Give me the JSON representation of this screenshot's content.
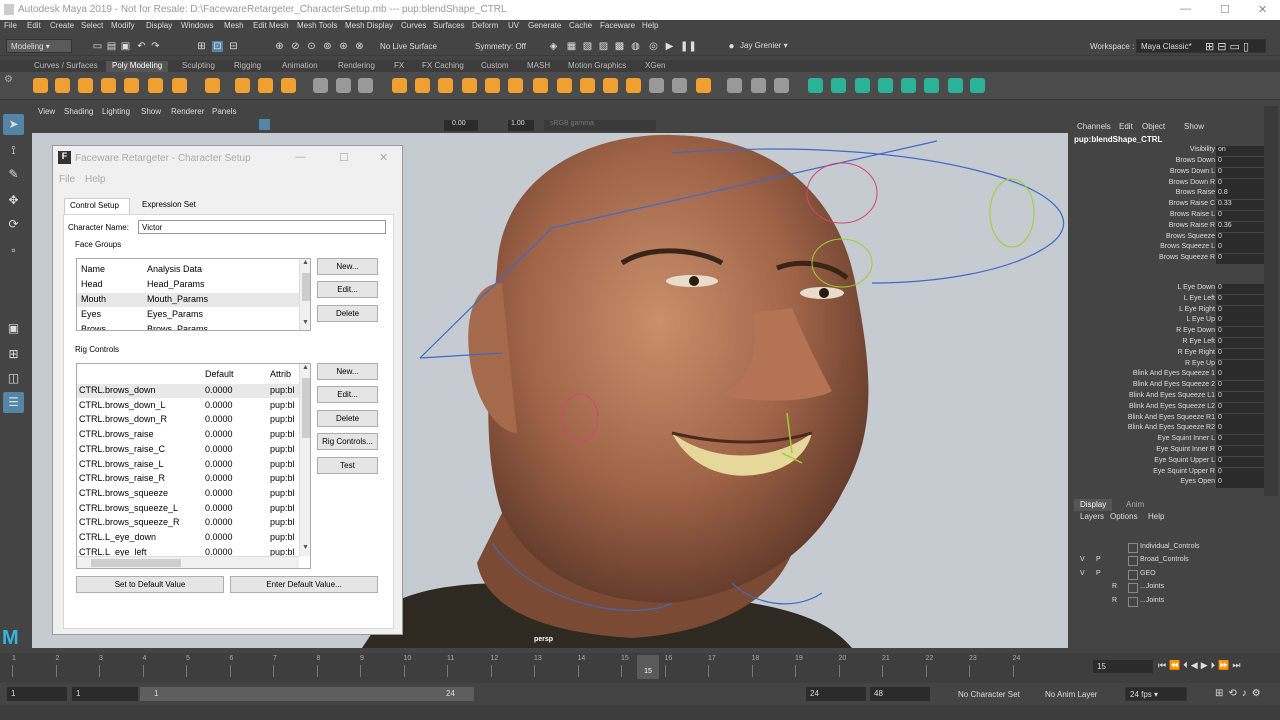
{
  "window": {
    "title": "Autodesk Maya 2019 - Not for Resale: D:\\FacewareRetargeter_CharacterSetup.mb  ---  pup:blendShape_CTRL"
  },
  "menubar": [
    "File",
    "Edit",
    "Create",
    "Select",
    "Modify",
    "Display",
    "Windows",
    "Mesh",
    "Edit Mesh",
    "Mesh Tools",
    "Mesh Display",
    "Curves",
    "Surfaces",
    "Deform",
    "UV",
    "Generate",
    "Cache",
    "Faceware",
    "Help"
  ],
  "statusline": {
    "mode": "Modeling",
    "live_surface": "No Live Surface",
    "symmetry": "Symmetry: Off",
    "user": "Jay Grenier",
    "workspace_label": "Workspace :",
    "workspace": "Maya Classic*"
  },
  "shelf_tabs": [
    "Curves / Surfaces",
    "Poly Modeling",
    "Sculpting",
    "Rigging",
    "Animation",
    "Rendering",
    "FX",
    "FX Caching",
    "Custom",
    "MASH",
    "Motion Graphics",
    "XGen"
  ],
  "shelf_active": "Poly Modeling",
  "panel_menu": [
    "View",
    "Shading",
    "Lighting",
    "Show",
    "Renderer",
    "Panels"
  ],
  "panel_toolbar": {
    "value1": "0.00",
    "value2": "1.00",
    "colorspace": "sRGB gamma"
  },
  "viewport": {
    "camera": "persp"
  },
  "channel_box": {
    "menu": [
      "Channels",
      "Edit",
      "Object",
      "Show"
    ],
    "node": "pup:blendShape_CTRL",
    "visibility_label": "Visibility",
    "visibility_value": "on",
    "group1": [
      {
        "n": "Brows Down",
        "v": "0"
      },
      {
        "n": "Brows Down L",
        "v": "0"
      },
      {
        "n": "Brows Down R",
        "v": "0"
      },
      {
        "n": "Brows Raise",
        "v": "0.8"
      },
      {
        "n": "Brows Raise C",
        "v": "0.33"
      },
      {
        "n": "Brows Raise L",
        "v": "0"
      },
      {
        "n": "Brows Raise R",
        "v": "0.36"
      },
      {
        "n": "Brows Squeeze",
        "v": "0"
      },
      {
        "n": "Brows Squeeze L",
        "v": "0"
      },
      {
        "n": "Brows Squeeze R",
        "v": "0"
      }
    ],
    "group2": [
      {
        "n": "L Eye Down",
        "v": "0"
      },
      {
        "n": "L Eye Left",
        "v": "0"
      },
      {
        "n": "L Eye Right",
        "v": "0"
      },
      {
        "n": "L Eye Up",
        "v": "0"
      },
      {
        "n": "R Eye Down",
        "v": "0"
      },
      {
        "n": "R Eye Left",
        "v": "0"
      },
      {
        "n": "R Eye Right",
        "v": "0"
      },
      {
        "n": "R Eye Up",
        "v": "0"
      },
      {
        "n": "Blink And Eyes Squeeze 1",
        "v": "0"
      },
      {
        "n": "Blink And Eyes Squeeze 2",
        "v": "0"
      },
      {
        "n": "Blink And Eyes Squeeze L1",
        "v": "0"
      },
      {
        "n": "Blink And Eyes Squeeze L2",
        "v": "0"
      },
      {
        "n": "Blink And Eyes Squeeze R1",
        "v": "0"
      },
      {
        "n": "Blink And Eyes Squeeze R2",
        "v": "0"
      },
      {
        "n": "Eye Squint Inner L",
        "v": "0"
      },
      {
        "n": "Eye Squint Inner R",
        "v": "0"
      },
      {
        "n": "Eye Squint Upper L",
        "v": "0"
      },
      {
        "n": "Eye Squint Upper R",
        "v": "0"
      },
      {
        "n": "Eyes Open",
        "v": "0"
      }
    ]
  },
  "layer_editor": {
    "tabs": [
      "Display",
      "Anim"
    ],
    "menu": [
      "Layers",
      "Options",
      "Help"
    ],
    "layers": [
      {
        "v": "",
        "p": "",
        "r": "",
        "name": "Individual_Controls"
      },
      {
        "v": "V",
        "p": "P",
        "r": "",
        "name": "Broad_Controls"
      },
      {
        "v": "V",
        "p": "P",
        "r": "",
        "name": "GEO"
      },
      {
        "v": "",
        "p": "",
        "r": "R",
        "name": "...Joints"
      },
      {
        "v": "",
        "p": "",
        "r": "R",
        "name": "...Joints"
      }
    ]
  },
  "timeline": {
    "ticks": [
      "1",
      "2",
      "3",
      "4",
      "5",
      "6",
      "7",
      "8",
      "9",
      "10",
      "11",
      "12",
      "13",
      "14",
      "15",
      "16",
      "17",
      "18",
      "19",
      "20",
      "21",
      "22",
      "23",
      "24"
    ],
    "current": "15",
    "current_field": "15"
  },
  "range": {
    "start": "1",
    "anim_start": "1",
    "slider_start": "1",
    "slider_end": "24",
    "end": "24",
    "anim_end": "48",
    "character_set": "No Character Set",
    "anim_layer": "No Anim Layer",
    "fps": "24 fps"
  },
  "dialog": {
    "title": "Faceware Retargeter - Character Setup",
    "menu": [
      "File",
      "Help"
    ],
    "tabs": [
      "Control Setup",
      "Expression Set"
    ],
    "character_name_label": "Character Name:",
    "character_name": "Victor",
    "face_groups_label": "Face Groups",
    "face_groups_headers": [
      "Name",
      "Analysis Data"
    ],
    "face_groups": [
      {
        "name": "Head",
        "data": "Head_Params"
      },
      {
        "name": "Mouth",
        "data": "Mouth_Params"
      },
      {
        "name": "Eyes",
        "data": "Eyes_Params"
      },
      {
        "name": "Brows",
        "data": "Brows_Params"
      }
    ],
    "face_group_buttons": [
      "New...",
      "Edit...",
      "Delete"
    ],
    "rig_controls_label": "Rig Controls",
    "rig_headers": [
      "",
      "Default",
      "Attrib"
    ],
    "rig_controls": [
      {
        "name": "CTRL.brows_down",
        "def": "0.0000",
        "attr": "pup:bl"
      },
      {
        "name": "CTRL.brows_down_L",
        "def": "0.0000",
        "attr": "pup:bl"
      },
      {
        "name": "CTRL.brows_down_R",
        "def": "0.0000",
        "attr": "pup:bl"
      },
      {
        "name": "CTRL.brows_raise",
        "def": "0.0000",
        "attr": "pup:bl"
      },
      {
        "name": "CTRL.brows_raise_C",
        "def": "0.0000",
        "attr": "pup:bl"
      },
      {
        "name": "CTRL.brows_raise_L",
        "def": "0.0000",
        "attr": "pup:bl"
      },
      {
        "name": "CTRL.brows_raise_R",
        "def": "0.0000",
        "attr": "pup:bl"
      },
      {
        "name": "CTRL.brows_squeeze",
        "def": "0.0000",
        "attr": "pup:bl"
      },
      {
        "name": "CTRL.brows_squeeze_L",
        "def": "0.0000",
        "attr": "pup:bl"
      },
      {
        "name": "CTRL.brows_squeeze_R",
        "def": "0.0000",
        "attr": "pup:bl"
      },
      {
        "name": "CTRL.L_eye_down",
        "def": "0.0000",
        "attr": "pup:bl"
      },
      {
        "name": "CTRL.L_eye_left",
        "def": "0.0000",
        "attr": "pup:bl"
      }
    ],
    "rig_buttons": [
      "New...",
      "Edit...",
      "Delete",
      "Rig Controls...",
      "Test"
    ],
    "set_default_button": "Set to Default Value",
    "enter_default_button": "Enter Default Value..."
  },
  "colors": {
    "accent": "#5285a6",
    "maya_blue": "#34b5e0",
    "shelf_orange": "#f0a030",
    "shelf_teal": "#2bb39a"
  }
}
